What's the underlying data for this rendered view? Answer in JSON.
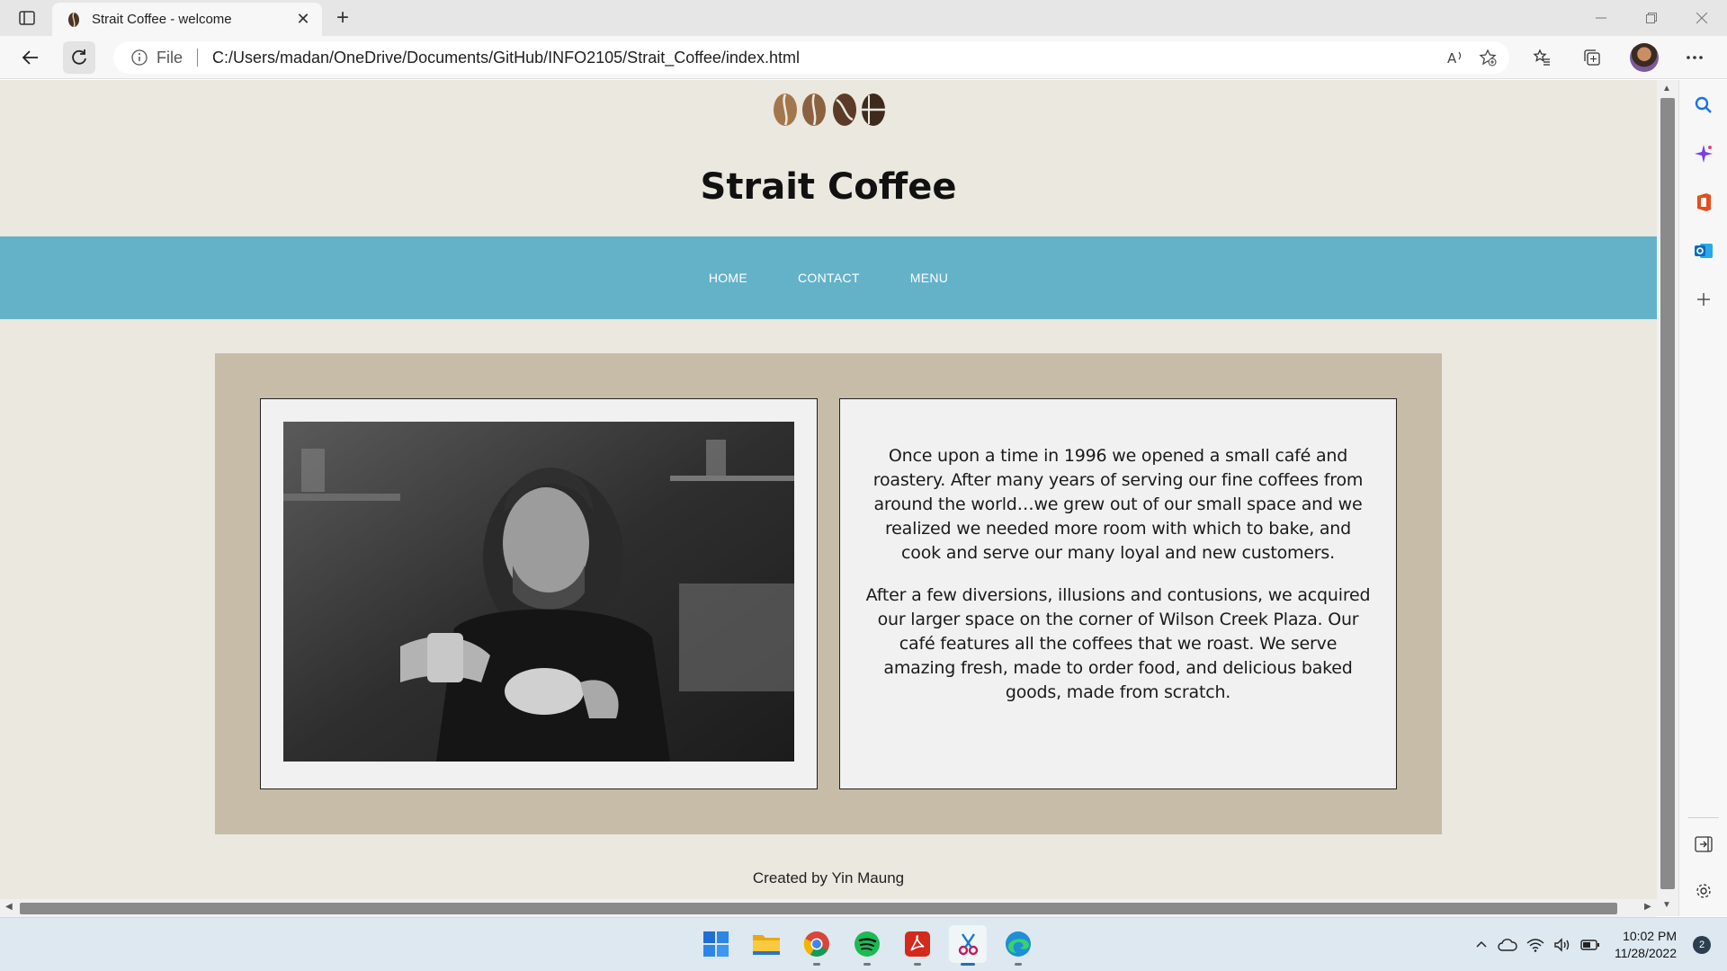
{
  "browser": {
    "tab_title": "Strait Coffee - welcome",
    "tab_close": "✕",
    "new_tab": "+",
    "address_prefix": "File",
    "url": "C:/Users/madan/OneDrive/Documents/GitHub/INFO2105/Strait_Coffee/index.html"
  },
  "page": {
    "site_title": "Strait Coffee",
    "nav": [
      {
        "label": "HOME"
      },
      {
        "label": "CONTACT"
      },
      {
        "label": "MENU"
      }
    ],
    "story": [
      "Once upon a time in 1996 we opened a small café and roastery. After many years of serving our fine coffees from around the world…we grew out of our small space and we realized we needed more room with which to bake, and cook and serve our many loyal and new customers.",
      "After a few diversions, illusions and contusions, we acquired our larger space on the corner of Wilson Creek Plaza. Our café features all the coffees that we roast. We serve amazing fresh, made to order food, and delicious baked goods, made from scratch."
    ],
    "footer": "Created by Yin Maung"
  },
  "taskbar": {
    "apps": [
      "start-icon",
      "file-explorer-icon",
      "chrome-icon",
      "spotify-icon",
      "acrobat-icon",
      "snipping-tool-icon",
      "edge-icon"
    ],
    "time": "10:02 PM",
    "date": "11/28/2022",
    "notification_count": "2"
  },
  "colors": {
    "page_bg": "#eae8df",
    "nav_bg": "#64b2c8",
    "content_bg": "#c7bca8",
    "panel_bg": "#f1f1f1"
  }
}
